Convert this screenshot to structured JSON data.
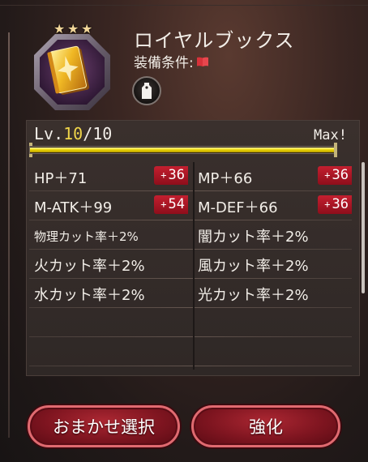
{
  "item": {
    "name": "ロイヤルブックス",
    "equip_label": "装備条件:",
    "equip_icon": "red-book-icon",
    "rarity_stars": 3,
    "image_icon": "golden-book-icon",
    "tag_icon": "tag-icon"
  },
  "level": {
    "prefix": "Lv.",
    "current": "10",
    "sep_max": "/10",
    "max_label": "Max!",
    "progress": 1.0
  },
  "stats": [
    {
      "left": {
        "text": "HP＋71",
        "bonus": "36"
      },
      "right": {
        "text": "MP＋66",
        "bonus": "36"
      }
    },
    {
      "left": {
        "text": "M-ATK＋99",
        "bonus": "54"
      },
      "right": {
        "text": "M-DEF＋66",
        "bonus": "36"
      }
    },
    {
      "left": {
        "text": "物理カット率＋2%"
      },
      "right": {
        "text": "闇カット率＋2%"
      }
    },
    {
      "left": {
        "text": "火カット率＋2%"
      },
      "right": {
        "text": "風カット率＋2%"
      }
    },
    {
      "left": {
        "text": "水カット率＋2%"
      },
      "right": {
        "text": "光カット率＋2%"
      }
    },
    {
      "left": {
        "text": ""
      },
      "right": {
        "text": ""
      }
    },
    {
      "left": {
        "text": ""
      },
      "right": {
        "text": ""
      }
    }
  ],
  "buttons": {
    "auto_select": "おまかせ選択",
    "enhance": "強化"
  },
  "colors": {
    "bonus_badge": "#b01a28",
    "level_current": "#f0d54a",
    "button_border": "#e06a70"
  }
}
